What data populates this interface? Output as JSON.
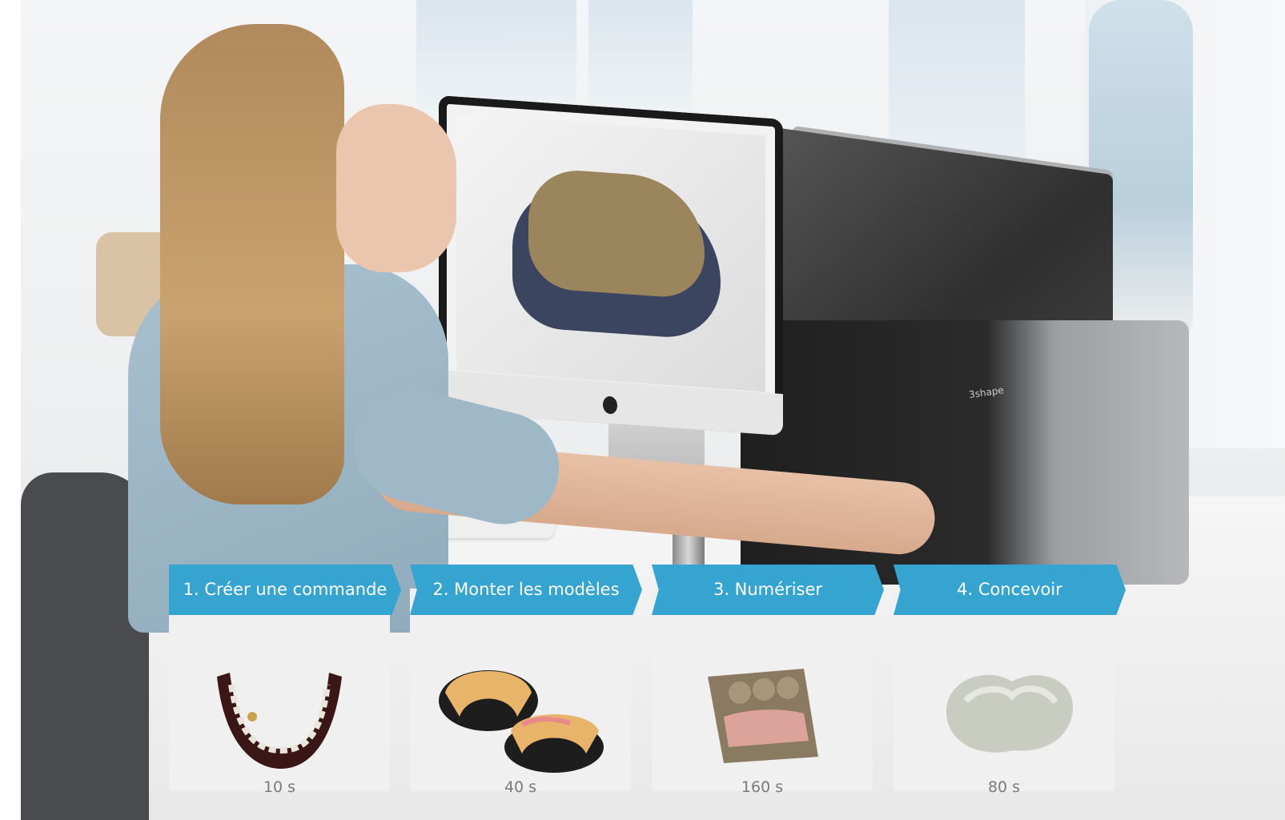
{
  "steps": [
    {
      "label": "1. Créer une commande",
      "time": "10 s",
      "illustration": "dental-arch-icon"
    },
    {
      "label": "2. Monter les modèles",
      "time": "40 s",
      "illustration": "plaster-models-icon"
    },
    {
      "label": "3. Numériser",
      "time": "160 s",
      "illustration": "scan-mesh-icon"
    },
    {
      "label": "4. Concevoir",
      "time": "80 s",
      "illustration": "crown-icon"
    }
  ],
  "scanner_brand": "3shape",
  "colors": {
    "accent": "#35a4d1",
    "card_background": "#f1f0f1",
    "time_text": "#7a7a7a"
  }
}
